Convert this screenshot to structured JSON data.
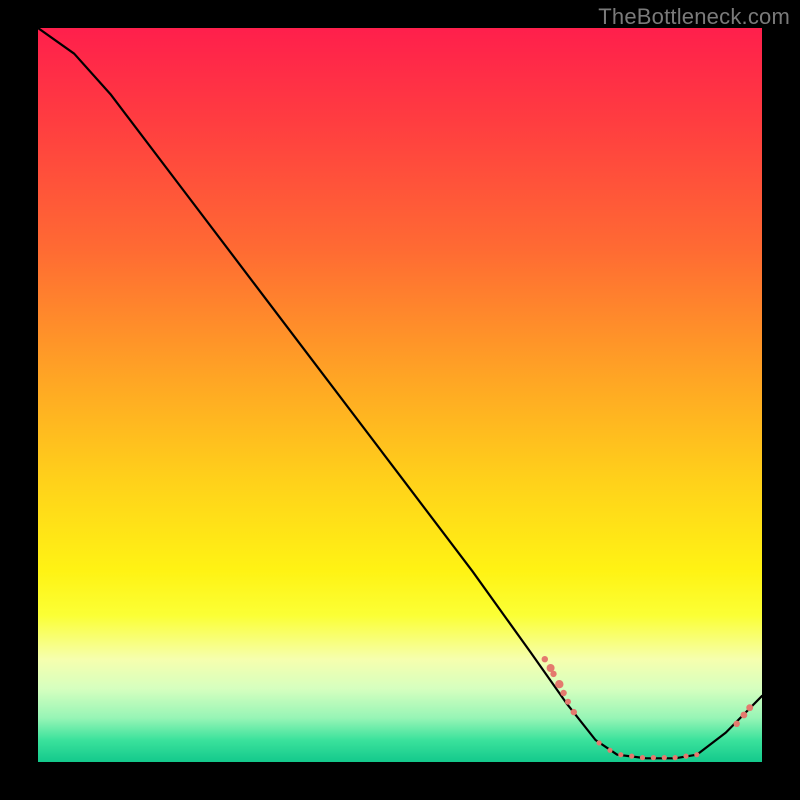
{
  "attribution": "TheBottleneck.com",
  "annotation_text": "",
  "colors": {
    "dot_fill": "#e47a6e",
    "curve_stroke": "#000000"
  },
  "chart_data": {
    "type": "line",
    "title": "",
    "xlabel": "",
    "ylabel": "",
    "xlim": [
      0,
      100
    ],
    "ylim": [
      0,
      100
    ],
    "grid": false,
    "legend": false,
    "curve_points": [
      {
        "x": 0,
        "y": 100
      },
      {
        "x": 5,
        "y": 96.5
      },
      {
        "x": 10,
        "y": 91
      },
      {
        "x": 20,
        "y": 78
      },
      {
        "x": 30,
        "y": 65
      },
      {
        "x": 40,
        "y": 52
      },
      {
        "x": 50,
        "y": 39
      },
      {
        "x": 60,
        "y": 26
      },
      {
        "x": 68,
        "y": 15
      },
      {
        "x": 73,
        "y": 8
      },
      {
        "x": 77,
        "y": 3
      },
      {
        "x": 80,
        "y": 1
      },
      {
        "x": 84,
        "y": 0.5
      },
      {
        "x": 88,
        "y": 0.5
      },
      {
        "x": 91,
        "y": 1
      },
      {
        "x": 95,
        "y": 4
      },
      {
        "x": 98,
        "y": 7
      },
      {
        "x": 100,
        "y": 9
      }
    ],
    "data_points": [
      {
        "x": 70.0,
        "y": 14.0,
        "r": 3.2
      },
      {
        "x": 70.8,
        "y": 12.8,
        "r": 4.0
      },
      {
        "x": 71.2,
        "y": 12.0,
        "r": 3.2
      },
      {
        "x": 72.0,
        "y": 10.6,
        "r": 4.2
      },
      {
        "x": 72.6,
        "y": 9.4,
        "r": 3.2
      },
      {
        "x": 73.2,
        "y": 8.2,
        "r": 3.0
      },
      {
        "x": 74.0,
        "y": 6.8,
        "r": 3.2
      },
      {
        "x": 77.5,
        "y": 2.6,
        "r": 2.6
      },
      {
        "x": 79.0,
        "y": 1.6,
        "r": 2.6
      },
      {
        "x": 80.5,
        "y": 1.0,
        "r": 2.6
      },
      {
        "x": 82.0,
        "y": 0.8,
        "r": 2.6
      },
      {
        "x": 83.5,
        "y": 0.6,
        "r": 2.6
      },
      {
        "x": 85.0,
        "y": 0.6,
        "r": 2.6
      },
      {
        "x": 86.5,
        "y": 0.6,
        "r": 2.6
      },
      {
        "x": 88.0,
        "y": 0.6,
        "r": 2.6
      },
      {
        "x": 89.5,
        "y": 0.8,
        "r": 2.6
      },
      {
        "x": 91.0,
        "y": 1.0,
        "r": 2.6
      },
      {
        "x": 96.5,
        "y": 5.2,
        "r": 3.2
      },
      {
        "x": 97.5,
        "y": 6.4,
        "r": 3.4
      },
      {
        "x": 98.3,
        "y": 7.4,
        "r": 3.4
      }
    ],
    "annotation": {
      "x": 84,
      "y": 2.5
    }
  }
}
